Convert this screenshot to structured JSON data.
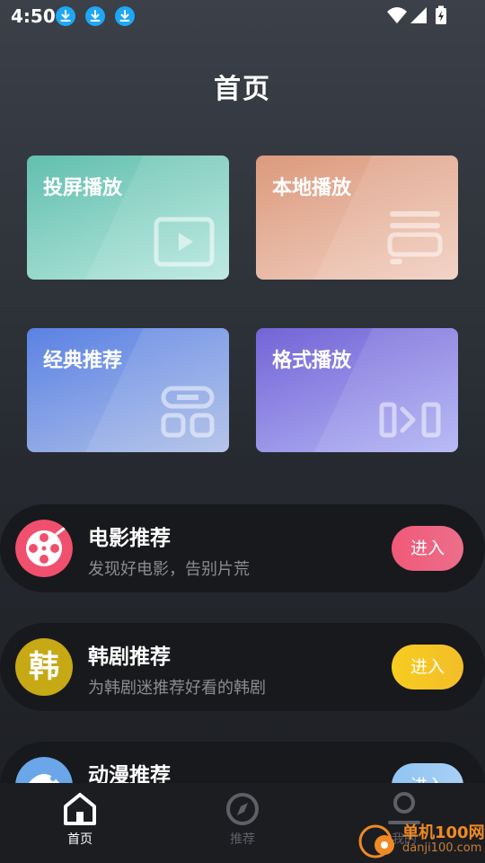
{
  "status_bar": {
    "time": "4:50"
  },
  "header": {
    "title": "首页"
  },
  "cards": [
    {
      "label": "投屏播放",
      "icon": "play-screen-icon"
    },
    {
      "label": "本地播放",
      "icon": "playlist-icon"
    },
    {
      "label": "经典推荐",
      "icon": "link-grid-icon"
    },
    {
      "label": "格式播放",
      "icon": "format-convert-icon"
    }
  ],
  "list": [
    {
      "title": "电影推荐",
      "subtitle": "发现好电影，告别片荒",
      "button": "进入",
      "accent": "#f0506e",
      "icon": "film-reel-icon"
    },
    {
      "title": "韩剧推荐",
      "subtitle": "为韩剧迷推荐好看的韩剧",
      "button": "进入",
      "accent": "#f7c623",
      "avatar_text": "韩",
      "icon": "korean-char-icon"
    },
    {
      "title": "动漫推荐",
      "subtitle": "",
      "button": "进入",
      "accent": "#6aa6e8",
      "icon": "anime-icon"
    }
  ],
  "tabs": [
    {
      "label": "首页",
      "active": true,
      "icon": "home-icon"
    },
    {
      "label": "推荐",
      "active": false,
      "icon": "compass-icon"
    },
    {
      "label": "我的",
      "active": false,
      "icon": "user-icon"
    }
  ],
  "watermark": {
    "name": "单机100网",
    "url": "danji100.com"
  }
}
